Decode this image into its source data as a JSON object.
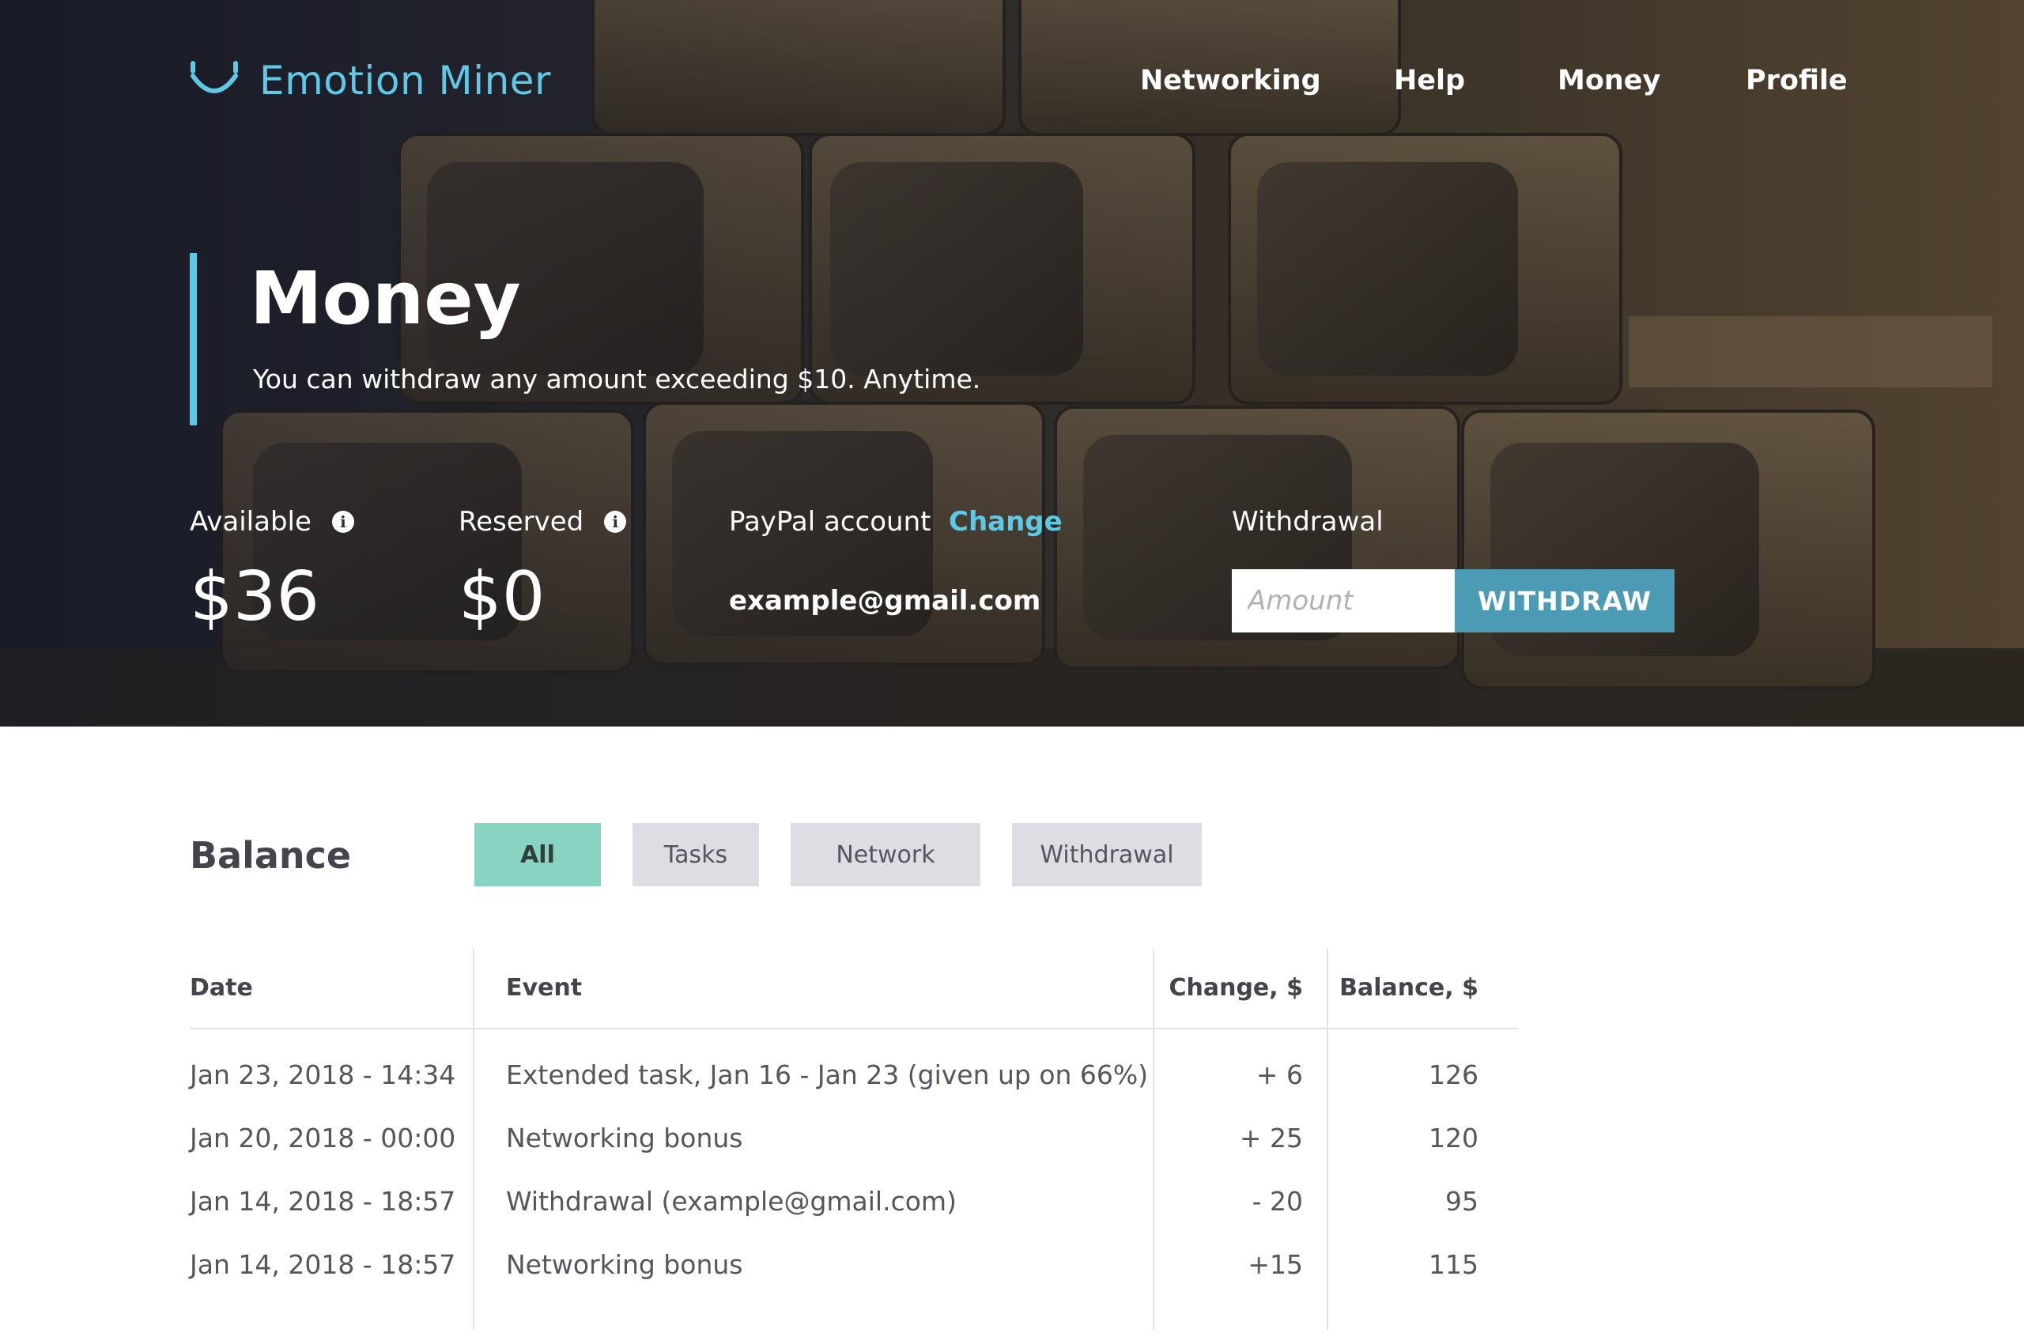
{
  "app": {
    "name": "Emotion Miner",
    "logo_icon": "smile-logo-icon"
  },
  "nav": {
    "items": [
      "Networking",
      "Help",
      "Money",
      "Profile"
    ]
  },
  "page": {
    "title": "Money",
    "subtitle": "You can withdraw any amount exceeding $10. Anytime."
  },
  "stats": {
    "available": {
      "label": "Available",
      "value": "$36",
      "icon": "info-icon"
    },
    "reserved": {
      "label": "Reserved",
      "value": "$0",
      "icon": "info-icon"
    }
  },
  "paypal": {
    "label": "PayPal account",
    "change_label": "Change",
    "email": "example@gmail.com"
  },
  "withdrawal": {
    "label": "Withdrawal",
    "placeholder": "Amount",
    "value": "",
    "button_label": "WITHDRAW"
  },
  "balance": {
    "title": "Balance",
    "filters": [
      "All",
      "Tasks",
      "Network",
      "Withdrawal"
    ],
    "active_filter": "All",
    "columns": [
      "Date",
      "Event",
      "Change, $",
      "Balance, $"
    ],
    "rows": [
      {
        "date": "Jan 23, 2018 - 14:34",
        "event": "Extended task, Jan 16 - Jan 23  (given up on 66%)",
        "change": "+ 6",
        "balance": "126"
      },
      {
        "date": "Jan 20, 2018 - 00:00",
        "event": "Networking bonus",
        "change": "+ 25",
        "balance": "120"
      },
      {
        "date": "Jan 14, 2018 - 18:57",
        "event": "Withdrawal (example@gmail.com)",
        "change": "- 20",
        "balance": "95"
      },
      {
        "date": "Jan 14, 2018 - 18:57",
        "event": "Networking bonus",
        "change": "+15",
        "balance": "115"
      }
    ]
  },
  "colors": {
    "accent": "#5ec8e5",
    "button": "#4a9bb3",
    "active_filter": "#88d3c1",
    "filter": "#dedde3"
  }
}
